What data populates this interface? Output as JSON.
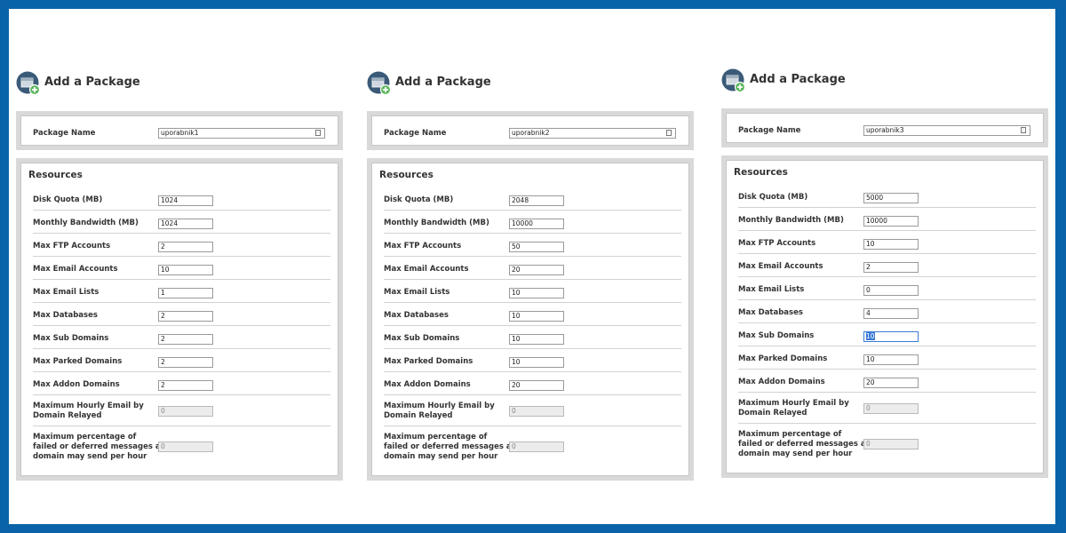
{
  "panels": [
    {
      "title": "Add a Package",
      "package_name_label": "Package Name",
      "package_name": "uporabnik1",
      "resources_title": "Resources",
      "fields": [
        {
          "label": "Disk Quota (MB)",
          "value": "1024"
        },
        {
          "label": "Monthly Bandwidth (MB)",
          "value": "1024"
        },
        {
          "label": "Max FTP Accounts",
          "value": "2"
        },
        {
          "label": "Max Email Accounts",
          "value": "10"
        },
        {
          "label": "Max Email Lists",
          "value": "1"
        },
        {
          "label": "Max Databases",
          "value": "2"
        },
        {
          "label": "Max Sub Domains",
          "value": "2"
        },
        {
          "label": "Max Parked Domains",
          "value": "2"
        },
        {
          "label": "Max Addon Domains",
          "value": "2"
        }
      ],
      "hourly_label_1": "Maximum Hourly Email by",
      "hourly_label_2": "Domain Relayed",
      "hourly_value": "0",
      "pct_label_1": "Maximum percentage of",
      "pct_label_2": "failed or deferred messages a",
      "pct_label_3": "domain may send per hour",
      "pct_value": "0"
    },
    {
      "title": "Add a Package",
      "package_name_label": "Package Name",
      "package_name": "uporabnik2",
      "resources_title": "Resources",
      "fields": [
        {
          "label": "Disk Quota (MB)",
          "value": "2048"
        },
        {
          "label": "Monthly Bandwidth (MB)",
          "value": "10000"
        },
        {
          "label": "Max FTP Accounts",
          "value": "50"
        },
        {
          "label": "Max Email Accounts",
          "value": "20"
        },
        {
          "label": "Max Email Lists",
          "value": "10"
        },
        {
          "label": "Max Databases",
          "value": "10"
        },
        {
          "label": "Max Sub Domains",
          "value": "10"
        },
        {
          "label": "Max Parked Domains",
          "value": "10"
        },
        {
          "label": "Max Addon Domains",
          "value": "20"
        }
      ],
      "hourly_label_1": "Maximum Hourly Email by",
      "hourly_label_2": "Domain Relayed",
      "hourly_value": "0",
      "pct_label_1": "Maximum percentage of",
      "pct_label_2": "failed or deferred messages a",
      "pct_label_3": "domain may send per hour",
      "pct_value": "0"
    },
    {
      "title": "Add a Package",
      "package_name_label": "Package Name",
      "package_name": "uporabnik3",
      "resources_title": "Resources",
      "fields": [
        {
          "label": "Disk Quota (MB)",
          "value": "5000"
        },
        {
          "label": "Monthly Bandwidth (MB)",
          "value": "10000"
        },
        {
          "label": "Max FTP Accounts",
          "value": "10"
        },
        {
          "label": "Max Email Accounts",
          "value": "2"
        },
        {
          "label": "Max Email Lists",
          "value": "0"
        },
        {
          "label": "Max Databases",
          "value": "4"
        },
        {
          "label": "Max Sub Domains",
          "value": "10"
        },
        {
          "label": "Max Parked Domains",
          "value": "10"
        },
        {
          "label": "Max Addon Domains",
          "value": "20"
        }
      ],
      "hourly_label_1": "Maximum Hourly Email by",
      "hourly_label_2": "Domain Relayed",
      "hourly_value": "0",
      "pct_label_1": "Maximum percentage of",
      "pct_label_2": "failed or deferred messages a",
      "pct_label_3": "domain may send per hour",
      "pct_value": "0"
    }
  ],
  "colors": {
    "frame_border": "#0a63a8",
    "icon_circle": "#3a5a78",
    "plus_badge": "#5cb85c"
  },
  "icons": {
    "package": "package-add-icon",
    "keyboard": "keyboard-icon"
  }
}
